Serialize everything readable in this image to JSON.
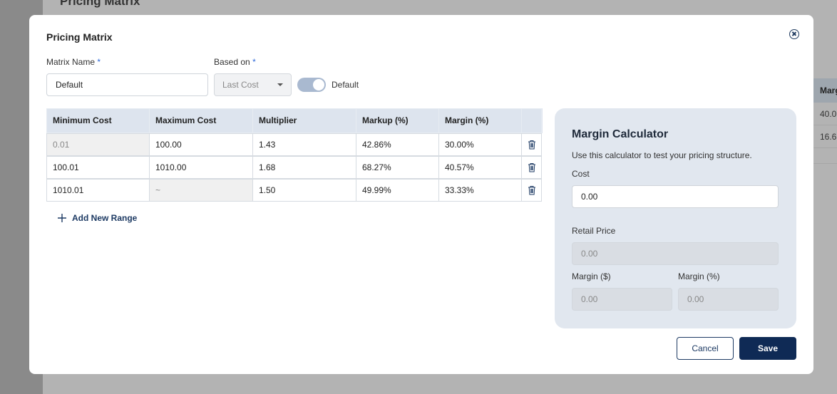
{
  "background": {
    "title": "Pricing Matrix",
    "table": {
      "header": "Marg",
      "rows": [
        "40.0",
        "16.6"
      ]
    }
  },
  "modal": {
    "title": "Pricing Matrix",
    "matrix_name_label": "Matrix Name",
    "matrix_name_value": "Default",
    "based_on_label": "Based on",
    "required_mark": "*",
    "based_on_value": "Last Cost",
    "toggle_label": "Default",
    "toggle_on": true,
    "table": {
      "headers": [
        "Minimum Cost",
        "Maximum Cost",
        "Multiplier",
        "Markup (%)",
        "Margin (%)"
      ],
      "rows": [
        {
          "min": "0.01",
          "max": "100.00",
          "multiplier": "1.43",
          "markup": "42.86%",
          "margin": "30.00%"
        },
        {
          "min": "100.01",
          "max": "1010.00",
          "multiplier": "1.68",
          "markup": "68.27%",
          "margin": "40.57%"
        },
        {
          "min": "1010.01",
          "max": "~",
          "multiplier": "1.50",
          "markup": "49.99%",
          "margin": "33.33%"
        }
      ]
    },
    "add_range_label": "Add New Range",
    "calculator": {
      "title": "Margin Calculator",
      "description": "Use this calculator to test your pricing structure.",
      "cost_label": "Cost",
      "cost_value": "0.00",
      "retail_label": "Retail Price",
      "retail_value": "0.00",
      "margin_dollar_label": "Margin ($)",
      "margin_dollar_value": "0.00",
      "margin_pct_label": "Margin (%)",
      "margin_pct_value": "0.00"
    },
    "cancel_label": "Cancel",
    "save_label": "Save"
  },
  "colors": {
    "primary": "#0f2a55",
    "required": "#2f6ad9",
    "table_header": "#dde4ee",
    "calculator_bg": "#e1e7ef"
  }
}
